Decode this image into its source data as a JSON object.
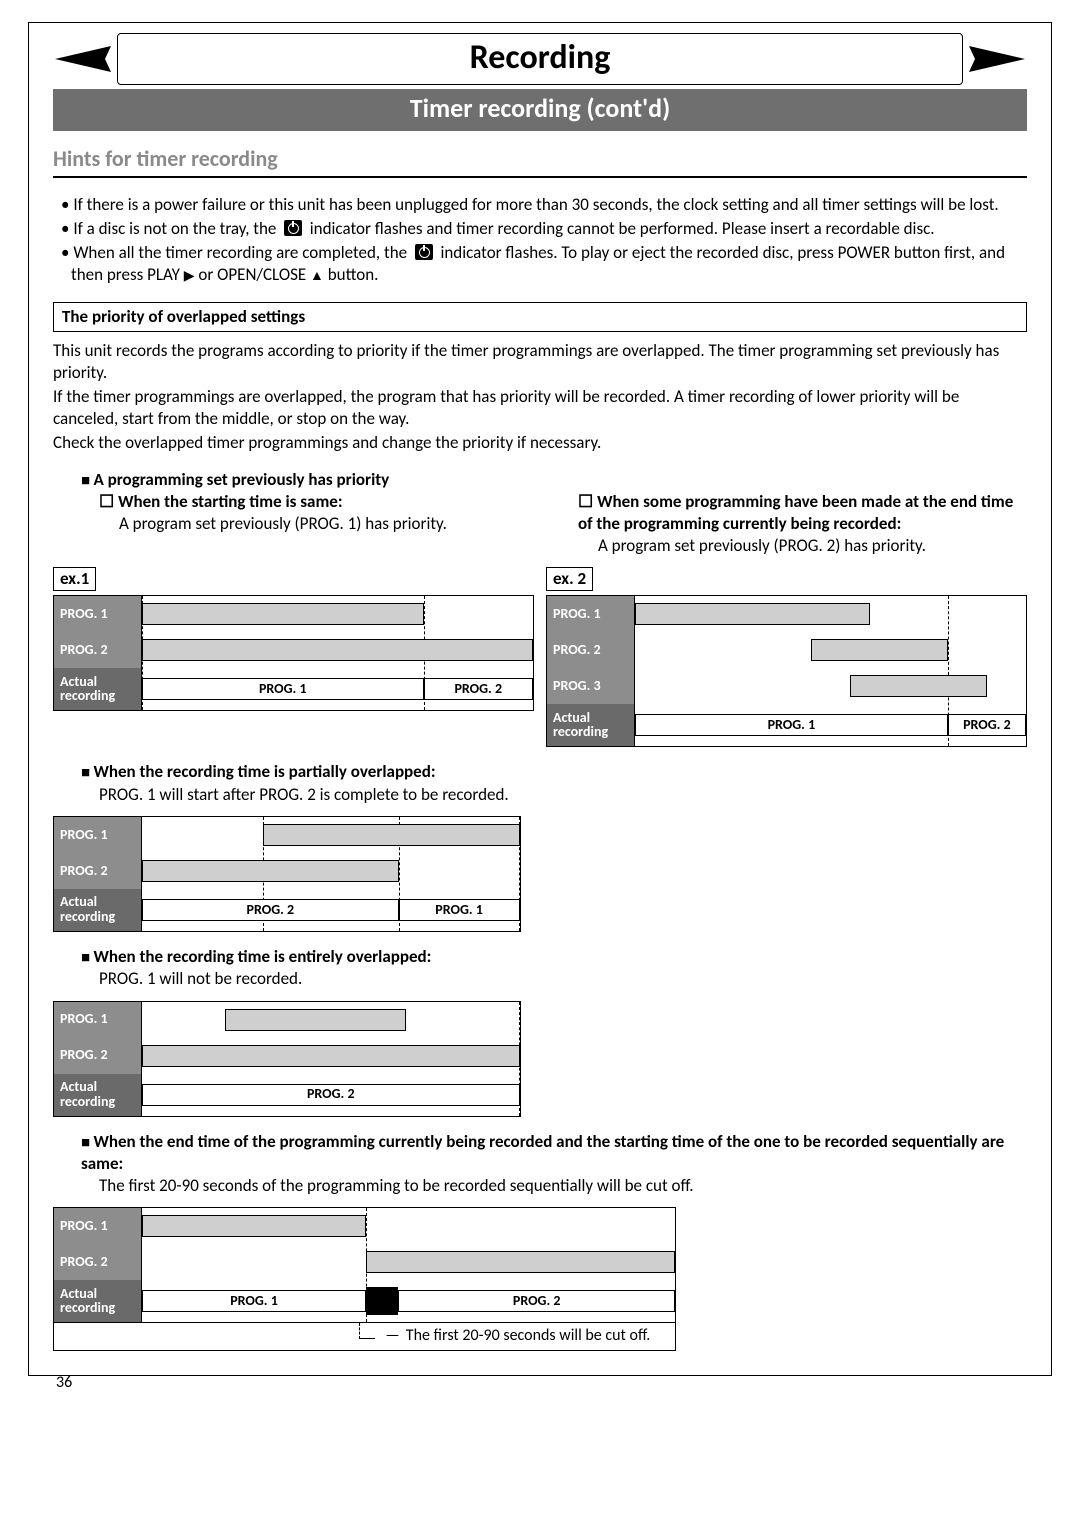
{
  "header": {
    "chapter": "Recording",
    "section": "Timer recording (cont'd)"
  },
  "hints": {
    "title": "Hints for timer recording",
    "bullets": [
      "If there is a power failure or this unit has been unplugged for more than 30 seconds, the clock setting and all timer settings will be lost.",
      "If a disc is not on the tray, the    indicator flashes and timer recording cannot be performed. Please insert a recordable disc.",
      "When all the timer recording are completed, the    indicator flashes. To play or eject the recorded disc, press POWER button first, and then press PLAY ▶ or OPEN/CLOSE ▲ button."
    ]
  },
  "priority": {
    "boxTitle": "The priority of overlapped settings",
    "intro": [
      "This unit records the programs according to priority if the timer programmings are overlapped. The timer programming set previously has priority.",
      "If the timer programmings are overlapped, the program that has priority will be recorded. A timer recording of lower priority will be canceled, start from the middle, or stop on the way.",
      "Check the overlapped timer programmings and change the priority if necessary."
    ],
    "case1": {
      "heading": "A programming set previously has priority",
      "left": {
        "sub": "When the starting time is same:",
        "desc": "A program set previously (PROG. 1) has priority.",
        "ex": "ex.1"
      },
      "right": {
        "sub": "When some programming have been made at the end time of the programming currently being recorded:",
        "desc": "A program set previously (PROG. 2) has priority.",
        "ex": "ex. 2"
      }
    },
    "case2": {
      "heading": "When the recording time is partially overlapped:",
      "desc": "PROG. 1 will start after PROG. 2 is complete to be recorded."
    },
    "case3": {
      "heading": "When the recording time is entirely overlapped:",
      "desc": "PROG. 1 will not be recorded."
    },
    "case4": {
      "heading": "When the end time of the programming currently being recorded and the starting time of the one to be recorded sequentially are same:",
      "desc": "The first 20-90 seconds of the programming to be recorded sequentially will be cut off.",
      "note": "The first 20-90 seconds will be cut off."
    }
  },
  "labels": {
    "prog1": "PROG. 1",
    "prog2": "PROG. 2",
    "prog3": "PROG. 3",
    "actual": "Actual recording"
  },
  "page_number": "36",
  "chart_data": [
    {
      "id": "ex1",
      "type": "bar",
      "title": "ex.1 — same starting time",
      "categories": [
        "PROG. 1",
        "PROG. 2",
        "Actual recording"
      ],
      "series": [
        {
          "name": "PROG. 1",
          "start": 0,
          "end": 72,
          "style": "gray"
        },
        {
          "name": "PROG. 2",
          "start": 0,
          "end": 100,
          "style": "gray"
        },
        {
          "name": "Actual PROG. 1",
          "row": "Actual recording",
          "start": 0,
          "end": 72,
          "label": "PROG. 1",
          "style": "white"
        },
        {
          "name": "Actual PROG. 2",
          "row": "Actual recording",
          "start": 72,
          "end": 100,
          "label": "PROG. 2",
          "style": "white"
        }
      ]
    },
    {
      "id": "ex2",
      "type": "bar",
      "title": "ex.2 — programming made at end time of current recording",
      "categories": [
        "PROG. 1",
        "PROG. 2",
        "PROG. 3",
        "Actual recording"
      ],
      "series": [
        {
          "name": "PROG. 1",
          "start": 0,
          "end": 60,
          "style": "gray"
        },
        {
          "name": "PROG. 2",
          "start": 45,
          "end": 80,
          "style": "gray"
        },
        {
          "name": "PROG. 3",
          "start": 55,
          "end": 90,
          "style": "gray"
        },
        {
          "name": "Actual PROG. 1",
          "row": "Actual recording",
          "start": 0,
          "end": 80,
          "label": "PROG. 1",
          "style": "white"
        },
        {
          "name": "Actual PROG. 2",
          "row": "Actual recording",
          "start": 80,
          "end": 100,
          "label": "PROG. 2",
          "style": "white"
        }
      ]
    },
    {
      "id": "partial",
      "type": "bar",
      "title": "Recording time partially overlapped",
      "categories": [
        "PROG. 1",
        "PROG. 2",
        "Actual recording"
      ],
      "series": [
        {
          "name": "PROG. 1",
          "start": 32,
          "end": 100,
          "style": "gray"
        },
        {
          "name": "PROG. 2",
          "start": 0,
          "end": 68,
          "style": "gray"
        },
        {
          "name": "Actual PROG. 2",
          "row": "Actual recording",
          "start": 0,
          "end": 68,
          "label": "PROG. 2",
          "style": "white"
        },
        {
          "name": "Actual PROG. 1",
          "row": "Actual recording",
          "start": 68,
          "end": 100,
          "label": "PROG. 1",
          "style": "white"
        }
      ]
    },
    {
      "id": "entire",
      "type": "bar",
      "title": "Recording time entirely overlapped",
      "categories": [
        "PROG. 1",
        "PROG. 2",
        "Actual recording"
      ],
      "series": [
        {
          "name": "PROG. 1",
          "start": 22,
          "end": 70,
          "style": "gray"
        },
        {
          "name": "PROG. 2",
          "start": 0,
          "end": 100,
          "style": "gray"
        },
        {
          "name": "Actual PROG. 2",
          "row": "Actual recording",
          "start": 0,
          "end": 100,
          "label": "PROG. 2",
          "style": "white"
        }
      ]
    },
    {
      "id": "sequential",
      "type": "bar",
      "title": "End time == start time of next",
      "categories": [
        "PROG. 1",
        "PROG. 2",
        "Actual recording"
      ],
      "series": [
        {
          "name": "PROG. 1",
          "start": 0,
          "end": 42,
          "style": "gray"
        },
        {
          "name": "PROG. 2",
          "start": 42,
          "end": 100,
          "style": "gray"
        },
        {
          "name": "Actual PROG. 1",
          "row": "Actual recording",
          "start": 0,
          "end": 42,
          "label": "PROG. 1",
          "style": "white"
        },
        {
          "name": "cutoff",
          "row": "Actual recording",
          "start": 42,
          "end": 48,
          "style": "black"
        },
        {
          "name": "Actual PROG. 2",
          "row": "Actual recording",
          "start": 48,
          "end": 100,
          "label": "PROG. 2",
          "style": "white"
        }
      ],
      "annotation": "The first 20-90 seconds will be cut off."
    }
  ]
}
